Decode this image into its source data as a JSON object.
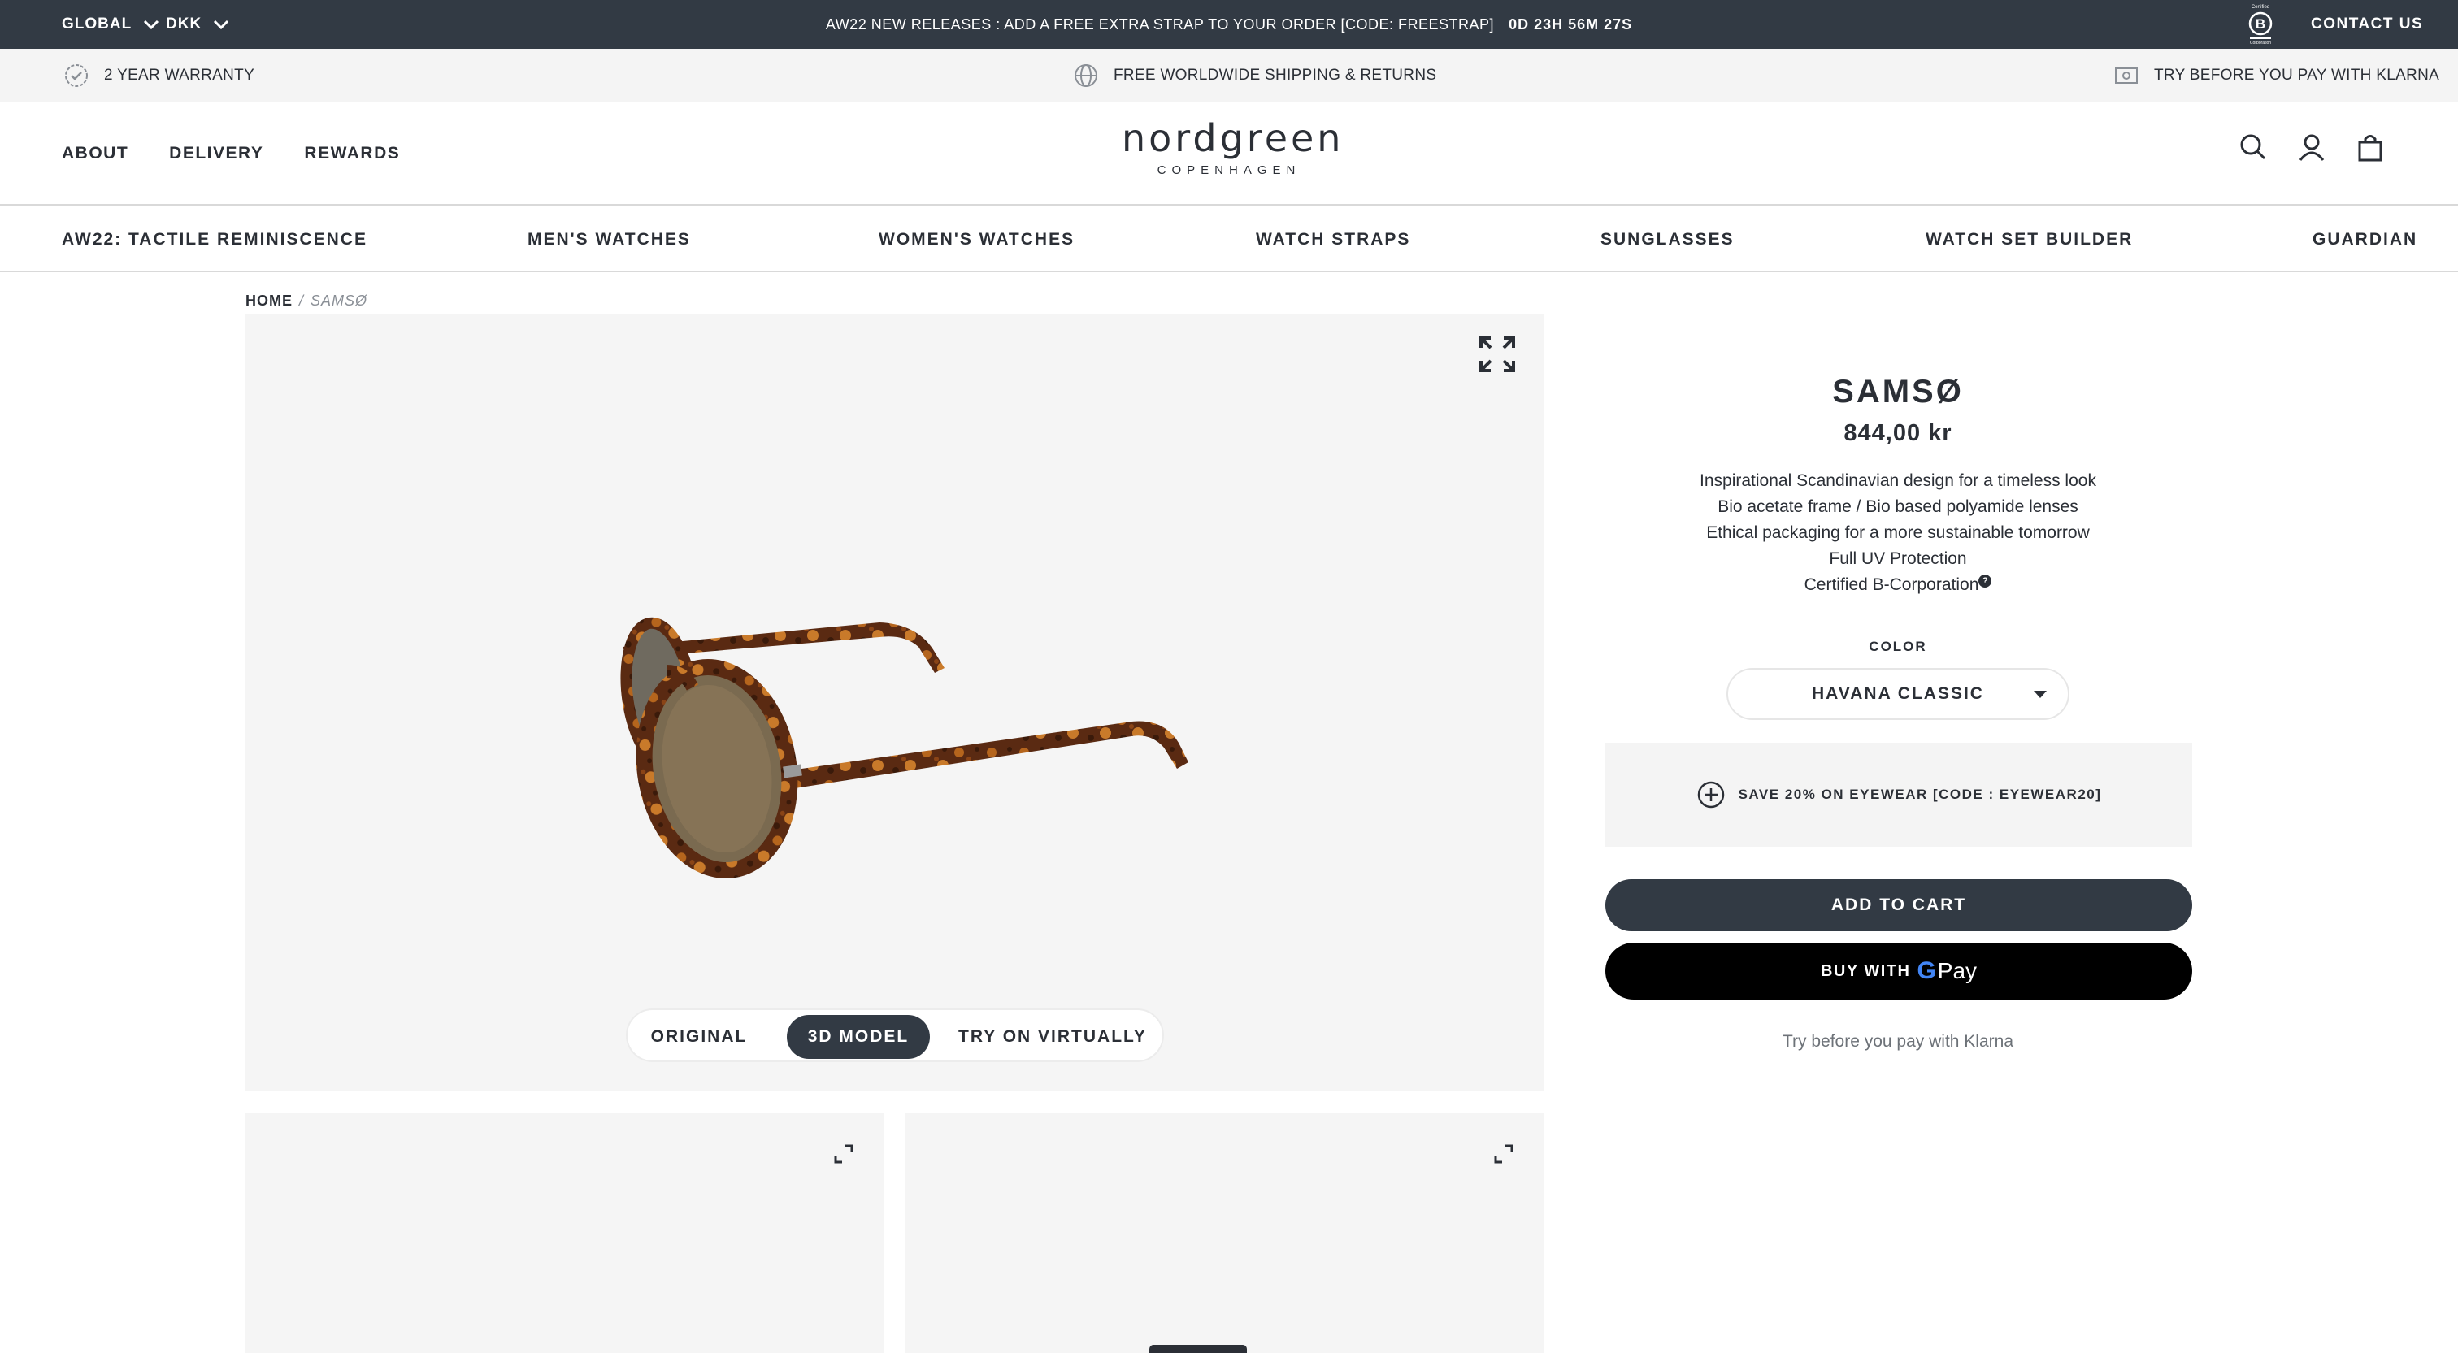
{
  "topbar": {
    "region": "GLOBAL",
    "currency": "DKK",
    "announcement": "AW22 NEW RELEASES : ADD A FREE EXTRA STRAP TO YOUR ORDER [CODE: FREESTRAP]",
    "countdown": "0D 23H 56M 27S",
    "contact": "CONTACT US",
    "bg_color": "#323a44"
  },
  "usps": {
    "warranty": "2 YEAR WARRANTY",
    "shipping": "FREE WORLDWIDE SHIPPING & RETURNS",
    "klarna": "TRY BEFORE YOU PAY WITH KLARNA"
  },
  "header": {
    "nav": [
      "ABOUT",
      "DELIVERY",
      "REWARDS"
    ],
    "logo": {
      "brand": "nordgreen",
      "sub": "COPENHAGEN"
    },
    "icons": [
      "search-icon",
      "account-icon",
      "cart-icon"
    ]
  },
  "categories": [
    "AW22: TACTILE REMINISCENCE",
    "MEN'S WATCHES",
    "WOMEN'S WATCHES",
    "WATCH STRAPS",
    "SUNGLASSES",
    "WATCH SET BUILDER",
    "GUARDIAN"
  ],
  "breadcrumb": {
    "home": "HOME",
    "separator": "/",
    "current": "SAMSØ"
  },
  "gallery": {
    "view_options": [
      "ORIGINAL",
      "3D MODEL",
      "TRY ON VIRTUALLY"
    ],
    "active_view": "3D MODEL"
  },
  "product": {
    "title": "SAMSØ",
    "price": "844,00 kr",
    "features": [
      "Inspirational Scandinavian design for a timeless look",
      "Bio acetate frame / Bio based polyamide lenses",
      "Ethical packaging for a more sustainable tomorrow",
      "Full UV Protection",
      "Certified B-Corporation"
    ],
    "color_label": "COLOR",
    "color_value": "HAVANA CLASSIC",
    "promo": "SAVE 20% ON EYEWEAR [CODE : EYEWEAR20]",
    "add_to_cart": "ADD TO CART",
    "buy_with": "BUY WITH",
    "gpay_g": "G",
    "gpay_pay": "Pay",
    "klarna_text": "Try before you pay with Klarna",
    "accent_color": "#323a44"
  }
}
